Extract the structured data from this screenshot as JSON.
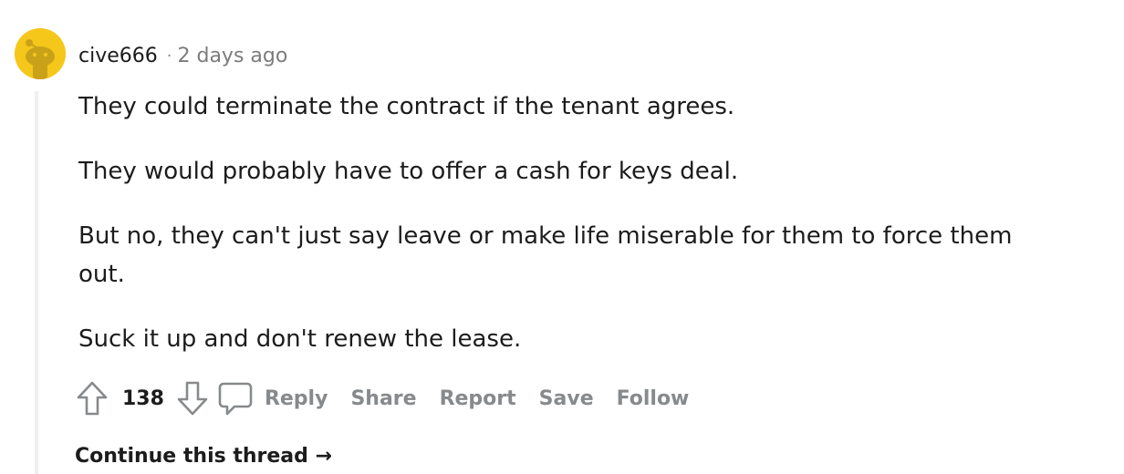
{
  "comment": {
    "author": "cive666",
    "separator": "·",
    "timestamp": "2 days ago",
    "paragraphs": [
      "They could terminate the contract if the tenant agrees.",
      "They would probably have to offer a cash for keys deal.",
      "But no, they can't just say leave or make life miserable for them to force them out.",
      "Suck it up and don't renew the lease."
    ],
    "score": "138"
  },
  "actions": {
    "reply": "Reply",
    "share": "Share",
    "report": "Report",
    "save": "Save",
    "follow": "Follow"
  },
  "continue_thread": "Continue this thread →",
  "colors": {
    "avatar_bg": "#f5c71a",
    "meta_text": "#7c7c7c",
    "action_text": "#878a8c",
    "thread_line": "#edeff1"
  },
  "icons": [
    "avatar-icon",
    "upvote-icon",
    "downvote-icon",
    "comment-bubble-icon"
  ]
}
